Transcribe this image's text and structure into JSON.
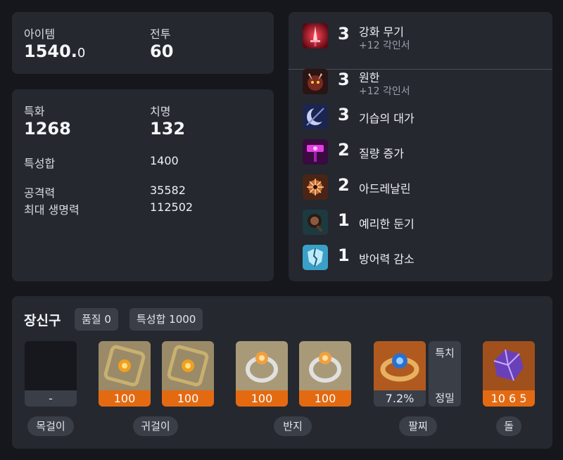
{
  "summary": {
    "item_label": "아이템",
    "item_value": "1540.",
    "item_value_decimal": "0",
    "combat_label": "전투",
    "combat_value": "60"
  },
  "stats": {
    "spec_label": "특화",
    "spec_value": "1268",
    "crit_label": "치명",
    "crit_value": "132",
    "total_label": "특성합",
    "total_value": "1400",
    "attack_label": "공격력",
    "attack_value": "35582",
    "hp_label": "최대 생명력",
    "hp_value": "112502"
  },
  "engravings": [
    {
      "level": "3",
      "name": "강화 무기",
      "sub": "+12 각인서",
      "icon": "sword-icon"
    },
    {
      "level": "3",
      "name": "원한",
      "sub": "+12 각인서",
      "icon": "demon-icon"
    },
    {
      "level": "3",
      "name": "기습의 대가",
      "sub": "",
      "icon": "crescent-icon"
    },
    {
      "level": "2",
      "name": "질량 증가",
      "sub": "",
      "icon": "hammer-icon"
    },
    {
      "level": "2",
      "name": "아드레날린",
      "sub": "",
      "icon": "adrenaline-icon"
    },
    {
      "level": "1",
      "name": "예리한 둔기",
      "sub": "",
      "icon": "mace-icon"
    },
    {
      "level": "1",
      "name": "방어력 감소",
      "sub": "",
      "icon": "broken-shield-icon"
    }
  ],
  "accessories": {
    "title": "장신구",
    "quality_chip": "품질 0",
    "total_chip": "특성합 1000",
    "necklace": {
      "value": "-",
      "label": "목걸이"
    },
    "earrings": {
      "values": [
        "100",
        "100"
      ],
      "label": "귀걸이"
    },
    "rings": {
      "values": [
        "100",
        "100"
      ],
      "label": "반지"
    },
    "bracelet": {
      "value": "7.2%",
      "label": "팔찌",
      "stat1": "특치",
      "stat2": "정밀"
    },
    "stone": {
      "value": "10 6 5",
      "label": "돌"
    }
  },
  "colors": {
    "background": "#15171c",
    "card": "#25282f",
    "chip": "#3a3e47",
    "quality_orange": "#e46a12"
  }
}
